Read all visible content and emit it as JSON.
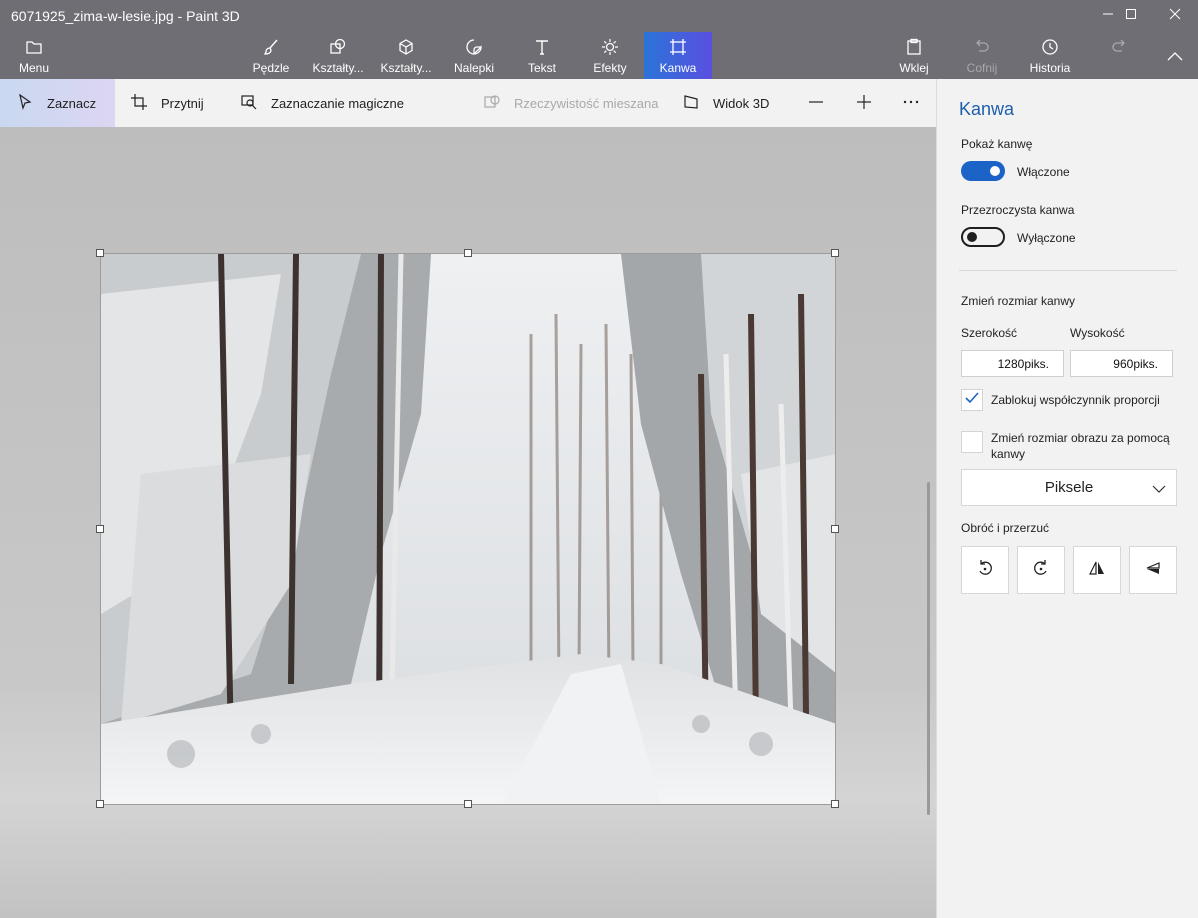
{
  "window": {
    "title": "6071925_zima-w-lesie.jpg - Paint 3D",
    "controls": [
      "minimize-icon",
      "maximize-icon",
      "close-icon"
    ]
  },
  "ribbon": {
    "menu_label": "Menu",
    "tools": [
      {
        "label": "Pędzle",
        "icon": "brush-icon"
      },
      {
        "label": "Kształty...",
        "icon": "2d-shapes-icon"
      },
      {
        "label": "Kształty...",
        "icon": "3d-shapes-icon"
      },
      {
        "label": "Nalepki",
        "icon": "stickers-icon"
      },
      {
        "label": "Tekst",
        "icon": "text-icon"
      },
      {
        "label": "Efekty",
        "icon": "effects-icon"
      },
      {
        "label": "Kanwa",
        "icon": "canvas-icon",
        "active": true
      }
    ],
    "paste_label": "Wklej",
    "undo_label": "Cofnij",
    "history_label": "Historia"
  },
  "toolbar": {
    "select_label": "Zaznacz",
    "crop_label": "Przytnij",
    "magic_select_label": "Zaznaczanie magiczne",
    "mixed_reality_label": "Rzeczywistość mieszana",
    "view3d_label": "Widok 3D"
  },
  "canvas": {
    "image_description": "snowy-forest-photo"
  },
  "panel": {
    "title": "Kanwa",
    "show_canvas_label": "Pokaż kanwę",
    "show_canvas_state": "Włączone",
    "show_canvas_on": true,
    "transparent_label": "Przezroczysta kanwa",
    "transparent_state": "Wyłączone",
    "transparent_on": false,
    "resize_title": "Zmień rozmiar kanwy",
    "width_label": "Szerokość",
    "height_label": "Wysokość",
    "width_value": "1280piks.",
    "height_value": "960piks.",
    "lock_ratio_label": "Zablokuj współczynnik proporcji",
    "lock_ratio_checked": true,
    "resize_image_label_line1": "Zmień rozmiar obrazu za pomocą",
    "resize_image_label_line2": "kanwy",
    "resize_image_checked": false,
    "unit_selected": "Piksele",
    "rotate_title": "Obróć i przerzuć",
    "rotate_buttons": [
      "rotate-left-icon",
      "rotate-right-icon",
      "flip-horizontal-icon",
      "flip-vertical-icon"
    ]
  },
  "colors": {
    "titlebar": "#6e6e74",
    "accent": "#1b63c6",
    "panel_title": "#1d5fae"
  }
}
